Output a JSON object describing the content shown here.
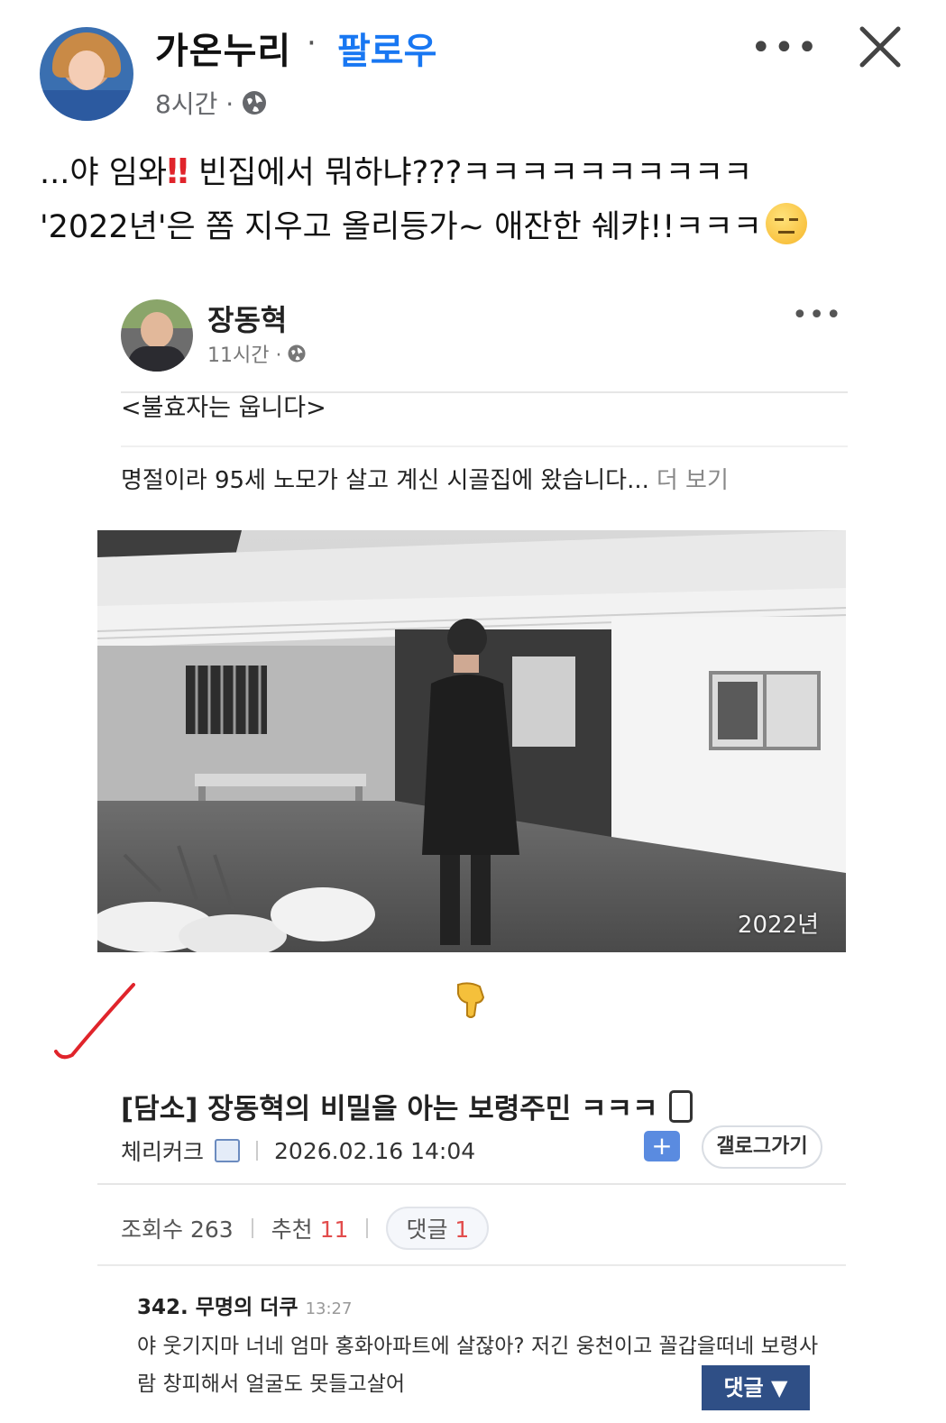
{
  "post": {
    "author": "가온누리",
    "separator": "·",
    "follow_label": "팔로우",
    "time": "8시간 ·",
    "more": "•••",
    "text_line1_a": "...야 임와",
    "text_line1_emoji": "‼",
    "text_line1_b": " 빈집에서 뭐하냐???ㅋㅋㅋㅋㅋㅋㅋㅋㅋㅋ",
    "text_line2": "'2022년'은 쫌 지우고 올리등가~ 애잔한 쉐캬!!ㅋㅋㅋ"
  },
  "shared_post": {
    "author": "장동혁",
    "time": "11시간 ·",
    "more": "•••",
    "headline": "<불효자는 웁니다>",
    "body": "명절이라 95세 노모가 살고 계신 시골집에 왔습니다...",
    "see_more": "더 보기",
    "photo_year": "2022년"
  },
  "article": {
    "title": "[담소] 장동혁의 비밀을 아는 보령주민 ㅋㅋㅋ",
    "writer": "체리커크",
    "datetime": "2026.02.16 14:04",
    "gallery_button": "갤로그가기",
    "folder_plus": "+",
    "views_label": "조회수 263",
    "recommend_label": "추천",
    "recommend_count": "11",
    "comments_label": "댓글",
    "comments_count": "1"
  },
  "comment": {
    "head": "342. 무명의 더쿠",
    "time": "13:27",
    "body": "야 웃기지마 너네 엄마 홍화아파트에 살잖아? 저긴 웅천이고 꼴갑을떠네 보령사람 창피해서 얼굴도 못들고살어",
    "reply_button": "댓글 ▼"
  },
  "colors": {
    "follow": "#1877f2",
    "bangbang": "#e0242b",
    "recommend": "#e24c4c",
    "reply_button": "#2f4f86",
    "check_mark": "#e0242b"
  },
  "icons": [
    "globe-icon",
    "more-icon",
    "close-icon",
    "pointing-down-hand-icon",
    "check-mark-icon",
    "phone-icon",
    "edit-icon",
    "folder-plus-icon"
  ]
}
